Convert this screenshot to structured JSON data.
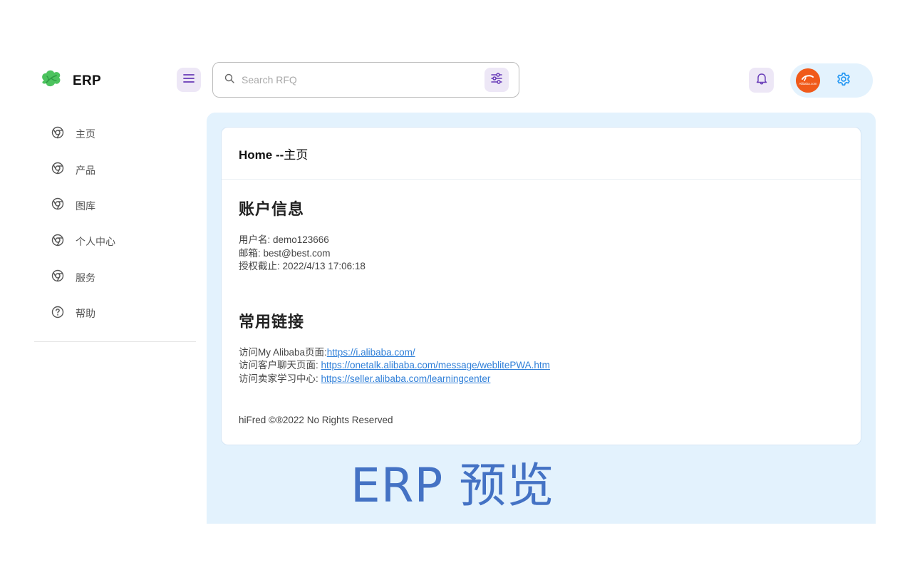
{
  "app": {
    "name": "ERP"
  },
  "search": {
    "placeholder": "Search RFQ",
    "value": ""
  },
  "sidebar": {
    "items": [
      {
        "label": "主页",
        "icon": "chrome-icon"
      },
      {
        "label": "产品",
        "icon": "chrome-icon"
      },
      {
        "label": "图库",
        "icon": "chrome-icon"
      },
      {
        "label": "个人中心",
        "icon": "chrome-icon"
      },
      {
        "label": "服务",
        "icon": "chrome-icon"
      },
      {
        "label": "帮助",
        "icon": "help-circle-icon"
      }
    ]
  },
  "header": {
    "bell_icon": "bell-icon",
    "settings_icon": "gear-icon",
    "avatar_text": "Alibaba.com"
  },
  "card": {
    "title_en": "Home --",
    "title_cn": "主页",
    "account": {
      "heading": "账户信息",
      "username": "用户名: demo123666",
      "email": "邮箱: best@best.com",
      "expiry": "授权截止: 2022/4/13 17:06:18"
    },
    "links": {
      "heading": "常用链接",
      "items": [
        {
          "prefix": "访问My Alibaba页面:",
          "url": "https://i.alibaba.com/"
        },
        {
          "prefix": "访问客户聊天页面: ",
          "url": "https://onetalk.alibaba.com/message/weblitePWA.htm"
        },
        {
          "prefix": "访问卖家学习中心: ",
          "url": "https://seller.alibaba.com/learningcenter"
        }
      ]
    },
    "footer": "hiFred ©®2022 No Rights Reserved"
  },
  "overlay": {
    "caption": "ERP 预览"
  },
  "colors": {
    "accent_purple": "#673ab7",
    "accent_blue": "#2196f3",
    "main_bg": "#e3f2fd",
    "link": "#2f7fd8",
    "overlay_text": "#4472c4"
  }
}
